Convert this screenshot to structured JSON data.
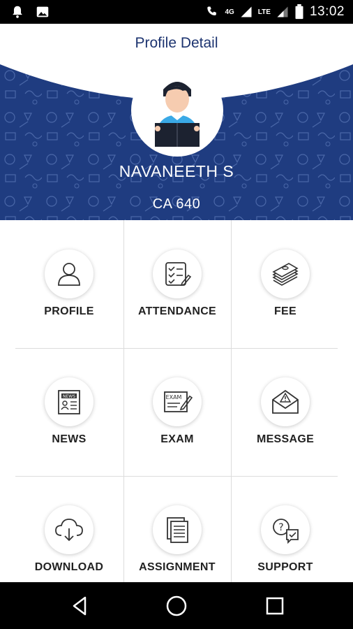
{
  "status_bar": {
    "time": "13:02",
    "network_label": "LTE",
    "data_label": "4G",
    "left_icons": [
      "notification-bell-icon",
      "image-icon"
    ],
    "right_icons": [
      "wifi-calling-icon",
      "signal-icon",
      "battery-icon"
    ]
  },
  "header": {
    "title": "Profile Detail",
    "student_name": "NAVANEETH S",
    "student_id": "CA 640",
    "banner_color": "#1f3c80",
    "title_color": "#1d3470"
  },
  "menu": [
    {
      "label": "PROFILE",
      "icon": "profile-icon"
    },
    {
      "label": "ATTENDANCE",
      "icon": "attendance-icon"
    },
    {
      "label": "FEE",
      "icon": "fee-icon"
    },
    {
      "label": "NEWS",
      "icon": "news-icon"
    },
    {
      "label": "EXAM",
      "icon": "exam-icon"
    },
    {
      "label": "MESSAGE",
      "icon": "message-icon"
    },
    {
      "label": "DOWNLOAD",
      "icon": "download-icon"
    },
    {
      "label": "ASSIGNMENT",
      "icon": "assignment-icon"
    },
    {
      "label": "SUPPORT",
      "icon": "support-icon"
    }
  ],
  "nav_bar": {
    "buttons": [
      "back-icon",
      "home-icon",
      "recents-icon"
    ]
  }
}
